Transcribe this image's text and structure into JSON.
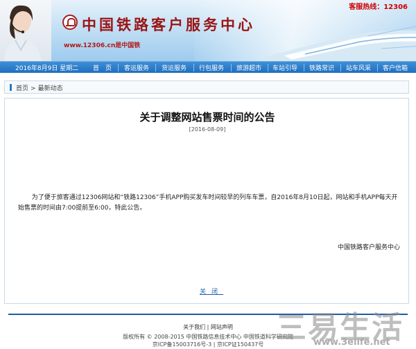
{
  "header": {
    "site_title": "中国铁路客户服务中心",
    "site_url": "www.12306.cn是中国铁",
    "hotline": "客服热线：12306"
  },
  "nav": {
    "date": "2016年8月9日 星期二",
    "items": [
      {
        "label": "首　页"
      },
      {
        "label": "客运服务"
      },
      {
        "label": "货运服务"
      },
      {
        "label": "行包服务"
      },
      {
        "label": "旅游超市"
      },
      {
        "label": "车站引导"
      },
      {
        "label": "铁路常识"
      },
      {
        "label": "站车风采"
      },
      {
        "label": "客户信箱"
      }
    ]
  },
  "breadcrumb": {
    "home": "首页",
    "separator": ">",
    "current": "最新动态"
  },
  "notice": {
    "title": "关于调整网站售票时间的公告",
    "date": "[2016-08-09]",
    "body": "为了便于旅客通过12306网站和“铁路12306”手机APP购买发车时间较早的列车车票，自2016年8月10日起，网站和手机APP每天开始售票的时间由7:00提前至6:00，特此公告。",
    "signature": "中国铁路客户服务中心",
    "close_label": "关闭"
  },
  "footer": {
    "about": "关于我们",
    "divider": "|",
    "statement": "网站声明",
    "copyright": "版权所有 © 2008-2015 中国铁路信息技术中心 中国铁道科学研究院",
    "icp": "京ICP备15003716号-3 | 京ICP证150437号"
  },
  "watermark": {
    "big": "三易生活",
    "url": "www.3elife.net"
  },
  "colors": {
    "nav_blue": "#1e6fc0",
    "title_red": "#9a1414",
    "link_blue": "#1a5cb0",
    "footer_line": "#1e5ba8"
  }
}
